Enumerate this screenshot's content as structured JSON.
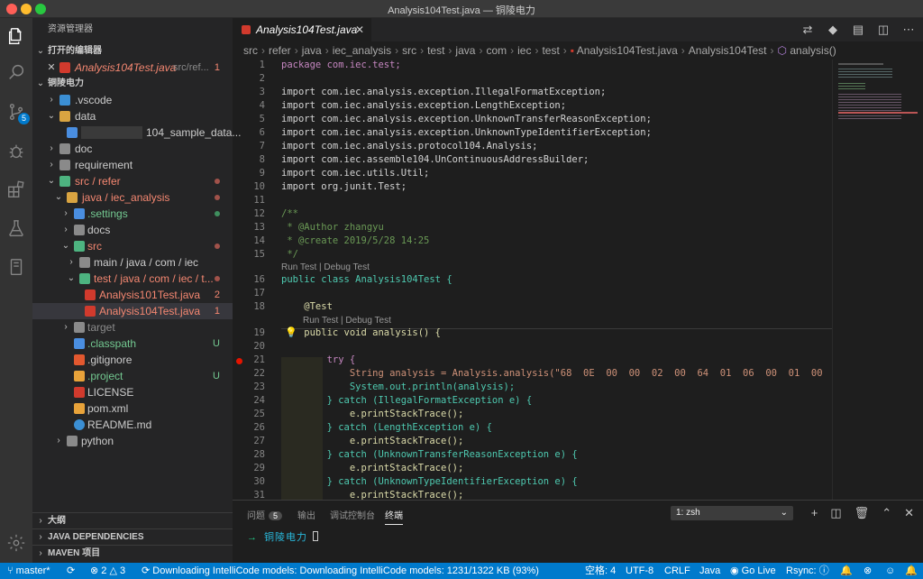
{
  "window": {
    "title": "Analysis104Test.java — 铜陵电力"
  },
  "activity": {
    "scm_badge": "5"
  },
  "sidebar": {
    "title": "资源管理器",
    "open_editors_label": "打开的编辑器",
    "open_editor": {
      "name": "Analysis104Test.java",
      "path": "src/ref...",
      "badge": "1"
    },
    "project_label": "铜陵电力",
    "tree": [
      {
        "label": ".vscode",
        "badge": ""
      },
      {
        "label": "data",
        "badge": ""
      },
      {
        "label": "104_sample_data...",
        "badge": ""
      },
      {
        "label": "doc",
        "badge": ""
      },
      {
        "label": "requirement",
        "badge": ""
      },
      {
        "label": "src / refer",
        "badge": ""
      },
      {
        "label": "java / iec_analysis",
        "badge": ""
      },
      {
        "label": ".settings",
        "badge": ""
      },
      {
        "label": "docs",
        "badge": ""
      },
      {
        "label": "src",
        "badge": ""
      },
      {
        "label": "main / java / com / iec",
        "badge": ""
      },
      {
        "label": "test / java / com / iec / t...",
        "badge": ""
      },
      {
        "label": "Analysis101Test.java",
        "badge": "2"
      },
      {
        "label": "Analysis104Test.java",
        "badge": "1"
      },
      {
        "label": "target",
        "badge": ""
      },
      {
        "label": ".classpath",
        "badge": "U"
      },
      {
        "label": ".gitignore",
        "badge": ""
      },
      {
        "label": ".project",
        "badge": "U"
      },
      {
        "label": "LICENSE",
        "badge": ""
      },
      {
        "label": "pom.xml",
        "badge": ""
      },
      {
        "label": "README.md",
        "badge": ""
      },
      {
        "label": "python",
        "badge": ""
      }
    ],
    "bottom_sections": [
      "大纲",
      "JAVA DEPENDENCIES",
      "MAVEN 项目"
    ]
  },
  "editor": {
    "tab_label": "Analysis104Test.java",
    "breadcrumb": [
      "src",
      "refer",
      "java",
      "iec_analysis",
      "src",
      "test",
      "java",
      "com",
      "iec",
      "test",
      "Analysis104Test.java",
      "Analysis104Test",
      "analysis()"
    ],
    "code_lens": "Run Test | Debug Test",
    "lines": [
      {
        "n": "1",
        "t": "package com.iec.test;"
      },
      {
        "n": "2",
        "t": ""
      },
      {
        "n": "3",
        "t": "import com.iec.analysis.exception.IllegalFormatException;"
      },
      {
        "n": "4",
        "t": "import com.iec.analysis.exception.LengthException;"
      },
      {
        "n": "5",
        "t": "import com.iec.analysis.exception.UnknownTransferReasonException;"
      },
      {
        "n": "6",
        "t": "import com.iec.analysis.exception.UnknownTypeIdentifierException;"
      },
      {
        "n": "7",
        "t": "import com.iec.analysis.protocol104.Analysis;"
      },
      {
        "n": "8",
        "t": "import com.iec.assemble104.UnContinuousAddressBuilder;"
      },
      {
        "n": "9",
        "t": "import com.iec.utils.Util;"
      },
      {
        "n": "10",
        "t": "import org.junit.Test;"
      },
      {
        "n": "11",
        "t": ""
      },
      {
        "n": "12",
        "t": "/**"
      },
      {
        "n": "13",
        "t": " * @Author zhangyu"
      },
      {
        "n": "14",
        "t": " * @create 2019/5/28 14:25"
      },
      {
        "n": "15",
        "t": " */"
      },
      {
        "n": "16",
        "t": "public class Analysis104Test {"
      },
      {
        "n": "17",
        "t": ""
      },
      {
        "n": "18",
        "t": "    @Test"
      },
      {
        "n": "19",
        "t": "    public void analysis() {"
      },
      {
        "n": "20",
        "t": ""
      },
      {
        "n": "21",
        "t": "        try {"
      },
      {
        "n": "22",
        "t": "            String analysis = Analysis.analysis(\"68  0E  00  00  02  00  64  01  06  00  01  00  00  00"
      },
      {
        "n": "23",
        "t": "            System.out.println(analysis);"
      },
      {
        "n": "24",
        "t": "        } catch (IllegalFormatException e) {"
      },
      {
        "n": "25",
        "t": "            e.printStackTrace();"
      },
      {
        "n": "26",
        "t": "        } catch (LengthException e) {"
      },
      {
        "n": "27",
        "t": "            e.printStackTrace();"
      },
      {
        "n": "28",
        "t": "        } catch (UnknownTransferReasonException e) {"
      },
      {
        "n": "29",
        "t": "            e.printStackTrace();"
      },
      {
        "n": "30",
        "t": "        } catch (UnknownTypeIdentifierException e) {"
      },
      {
        "n": "31",
        "t": "            e.printStackTrace();"
      }
    ]
  },
  "panel": {
    "tabs": [
      "问题",
      "输出",
      "调试控制台",
      "终端"
    ],
    "problems_count": "5",
    "terminal_select": "1: zsh",
    "prompt_arrow": "→",
    "prompt_dir": "铜陵电力"
  },
  "statusbar": {
    "branch": "master*",
    "errors": "2",
    "warnings": "3",
    "message": "Downloading IntelliCode models: Downloading IntelliCode models: 1231/1322 KB (93%)",
    "spaces": "空格: 4",
    "encoding": "UTF-8",
    "eol": "CRLF",
    "language": "Java",
    "golive": "Go Live",
    "rsync": "Rsync:"
  },
  "colors": {
    "accent": "#007acc",
    "error": "#f48771",
    "modified": "#e2c08d",
    "untracked": "#73c991"
  }
}
